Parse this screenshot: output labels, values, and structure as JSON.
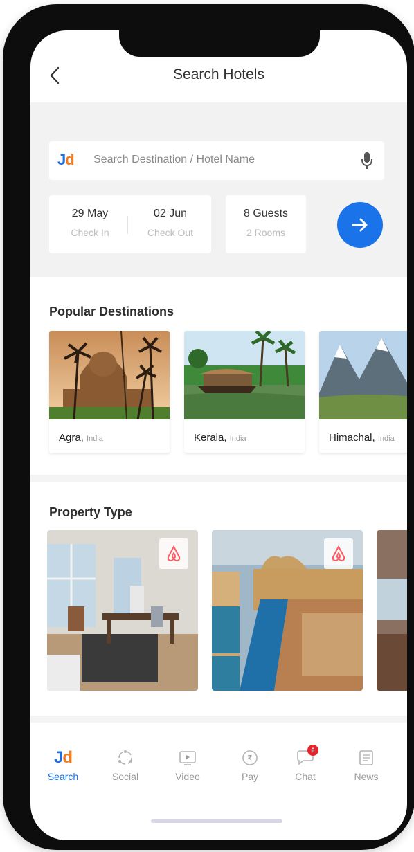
{
  "header": {
    "title": "Search Hotels"
  },
  "search": {
    "logo_j": "J",
    "logo_d": "d",
    "placeholder": "Search Destination / Hotel Name"
  },
  "dates": {
    "check_in_date": "29 May",
    "check_in_label": "Check In",
    "check_out_date": "02 Jun",
    "check_out_label": "Check Out"
  },
  "guests": {
    "count": "8 Guests",
    "rooms": "2 Rooms"
  },
  "popular": {
    "title": "Popular Destinations",
    "items": [
      {
        "city": "Agra,",
        "country": "India"
      },
      {
        "city": "Kerala,",
        "country": "India"
      },
      {
        "city": "Himachal,",
        "country": "India"
      }
    ]
  },
  "property": {
    "title": "Property Type"
  },
  "nav": {
    "items": [
      {
        "label": "Search"
      },
      {
        "label": "Social"
      },
      {
        "label": "Video"
      },
      {
        "label": "Pay"
      },
      {
        "label": "Chat"
      },
      {
        "label": "News"
      }
    ],
    "chat_badge": "6"
  },
  "colors": {
    "accent": "#1a73e8",
    "jd_orange": "#f07b1b",
    "badge_red": "#e8222a"
  },
  "icons": [
    "back-arrow-icon",
    "mic-icon",
    "arrow-right-icon",
    "airbnb-icon",
    "social-icon",
    "video-icon",
    "pay-icon",
    "chat-icon",
    "news-icon"
  ]
}
